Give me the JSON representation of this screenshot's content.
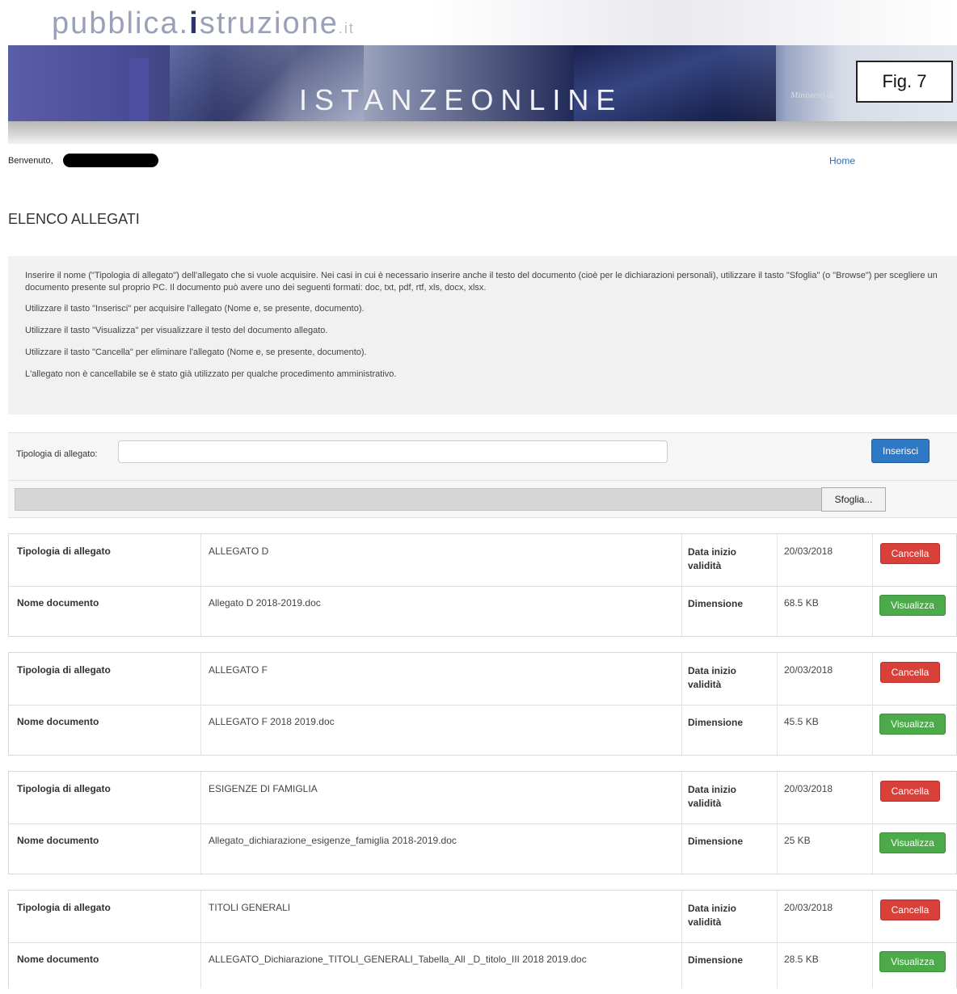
{
  "header": {
    "logo_part1": "pubblica.",
    "logo_i": "i",
    "logo_part2": "struzione",
    "logo_it": ".it",
    "banner_title": "ISTANZEONLINE",
    "banner_right": "Ministero del",
    "fig_label": "Fig. 7"
  },
  "nav": {
    "welcome": "Benvenuto,",
    "home": "Home"
  },
  "page_title": "ELENCO ALLEGATI",
  "instructions": [
    "Inserire il nome (\"Tipologia di allegato\") dell'allegato che si vuole acquisire. Nei casi in cui è necessario inserire anche il testo del documento (cioè per le dichiarazioni personali), utilizzare il tasto \"Sfoglia\" (o \"Browse\") per scegliere un documento presente sul proprio PC. Il documento può avere uno dei seguenti formati: doc, txt, pdf, rtf, xls, docx, xlsx.",
    "Utilizzare il tasto \"Inserisci\" per acquisire l'allegato (Nome e, se presente, documento).",
    "Utilizzare il tasto \"Visualizza\" per visualizzare il testo del documento allegato.",
    "Utilizzare il tasto \"Cancella\" per eliminare l'allegato (Nome e, se presente, documento).",
    "L'allegato non è cancellabile se è stato già utilizzato per qualche procedimento amministrativo."
  ],
  "form": {
    "tipologia_label": "Tipologia di allegato:",
    "tipologia_value": "",
    "insert_button": "Inserisci",
    "browse_button": "Sfoglia..."
  },
  "labels": {
    "tipologia": "Tipologia di allegato",
    "nome": "Nome documento",
    "data": "Data inizio validità",
    "dimensione": "Dimensione",
    "cancel": "Cancella",
    "view": "Visualizza"
  },
  "attachments": [
    {
      "tipologia": "ALLEGATO D",
      "data": "20/03/2018",
      "nome": "Allegato D 2018-2019.doc",
      "dimensione": "68.5 KB"
    },
    {
      "tipologia": "ALLEGATO F",
      "data": "20/03/2018",
      "nome": "ALLEGATO F 2018 2019.doc",
      "dimensione": "45.5 KB"
    },
    {
      "tipologia": "ESIGENZE DI FAMIGLIA",
      "data": "20/03/2018",
      "nome": "Allegato_dichiarazione_esigenze_famiglia 2018-2019.doc",
      "dimensione": "25 KB"
    },
    {
      "tipologia": "TITOLI GENERALI",
      "data": "20/03/2018",
      "nome": "ALLEGATO_Dichiarazione_TITOLI_GENERALI_Tabella_All _D_titolo_III 2018 2019.doc",
      "dimensione": "28.5 KB"
    }
  ],
  "colors": {
    "insert": "#2f78c4",
    "cancel": "#d9403a",
    "view": "#4caa4a",
    "link": "#2d6ab0"
  }
}
